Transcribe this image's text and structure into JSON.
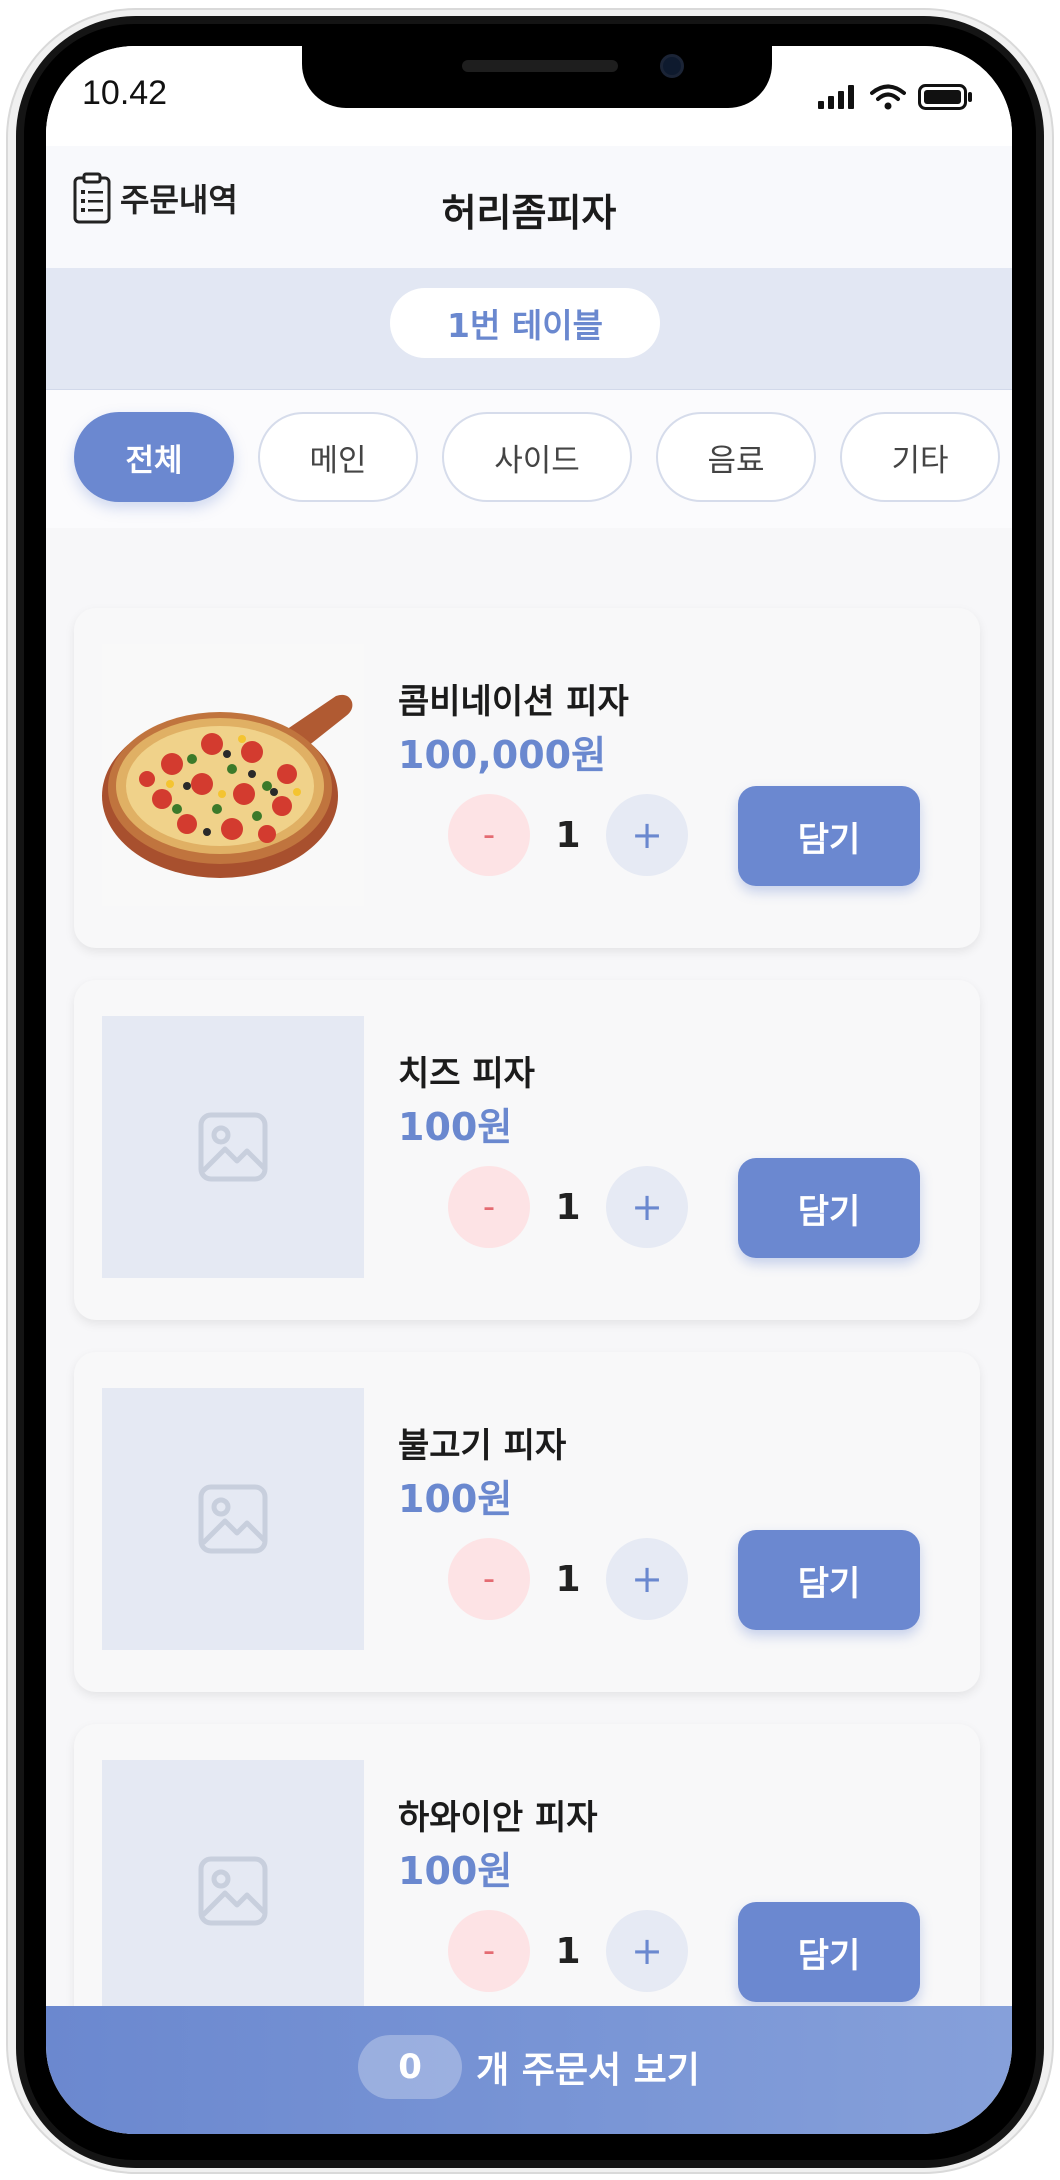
{
  "status_bar": {
    "time": "10.42"
  },
  "header": {
    "order_history_label": "주문내역",
    "store_title": "허리좀피자"
  },
  "table": {
    "label": "1번 테이블"
  },
  "categories": [
    {
      "label": "전체",
      "active": true
    },
    {
      "label": "메인",
      "active": false
    },
    {
      "label": "사이드",
      "active": false
    },
    {
      "label": "음료",
      "active": false
    },
    {
      "label": "기타",
      "active": false
    }
  ],
  "menu_items": [
    {
      "name": "콤비네이션 피자",
      "price": "100,000원",
      "quantity": "1",
      "minus": "-",
      "plus": "+",
      "add_label": "담기",
      "has_photo": true
    },
    {
      "name": "치즈 피자",
      "price": "100원",
      "quantity": "1",
      "minus": "-",
      "plus": "+",
      "add_label": "담기",
      "has_photo": false
    },
    {
      "name": "불고기 피자",
      "price": "100원",
      "quantity": "1",
      "minus": "-",
      "plus": "+",
      "add_label": "담기",
      "has_photo": false
    },
    {
      "name": "하와이안 피자",
      "price": "100원",
      "quantity": "1",
      "minus": "-",
      "plus": "+",
      "add_label": "담기",
      "has_photo": false
    }
  ],
  "order_bar": {
    "count": "0",
    "label": "개 주문서 보기"
  },
  "colors": {
    "accent": "#6b88d0",
    "minus_bg": "#fde3e5",
    "plus_bg": "#e6eaf4"
  }
}
